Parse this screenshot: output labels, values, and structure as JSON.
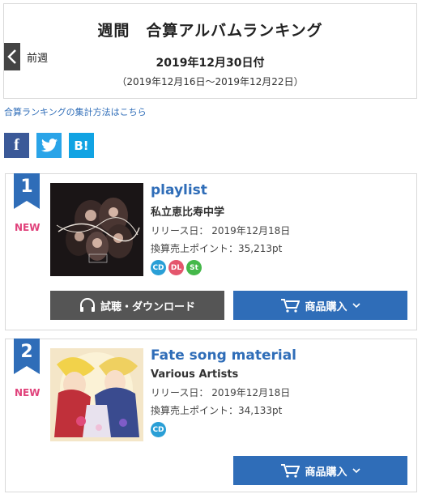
{
  "header": {
    "title": "週間　合算アルバムランキング",
    "prev_label": "前週",
    "date": "2019年12月30日付",
    "range": "（2019年12月16日〜2019年12月22日）"
  },
  "method_link": "合算ランキングの集計方法はこちら",
  "share": {
    "facebook": "f",
    "hatena": "B!"
  },
  "colors": {
    "accent": "#2f6db8",
    "new": "#e0427b",
    "listen_btn": "#555555"
  },
  "items": [
    {
      "rank": "1",
      "badge": "NEW",
      "title": "playlist",
      "artist": "私立恵比寿中学",
      "release": "リリース日：  2019年12月18日",
      "points": "換算売上ポイント：35,213pt",
      "formats": [
        "CD",
        "DL",
        "St"
      ],
      "listen_label": "試聴・ダウンロード",
      "buy_label": "商品購入"
    },
    {
      "rank": "2",
      "badge": "NEW",
      "title": "Fate song material",
      "artist": "Various Artists",
      "release": "リリース日：  2019年12月18日",
      "points": "換算売上ポイント：34,133pt",
      "formats": [
        "CD"
      ],
      "buy_label": "商品購入"
    }
  ]
}
